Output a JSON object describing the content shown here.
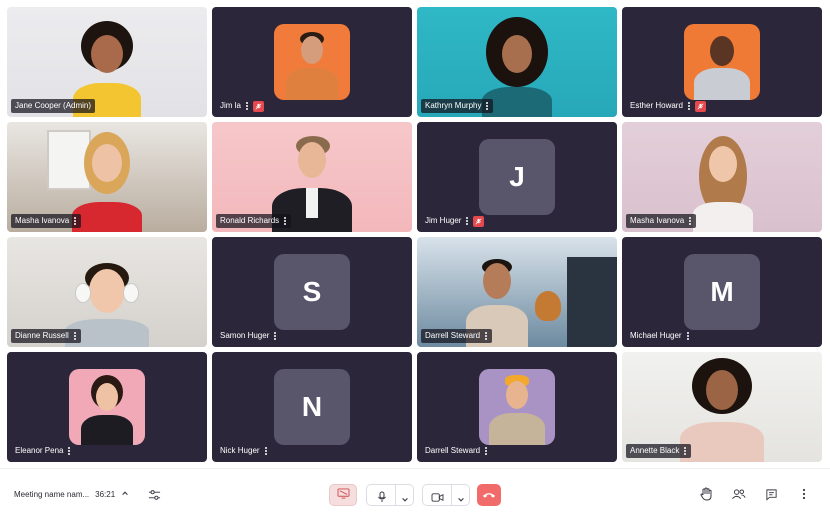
{
  "participants": [
    {
      "name": "Jane Cooper (Admin)",
      "kind": "photo",
      "muted": false
    },
    {
      "name": "Jim la",
      "kind": "avatar-photo",
      "muted": true
    },
    {
      "name": "Kathryn Murphy",
      "kind": "photo",
      "muted": false
    },
    {
      "name": "Esther Howard",
      "kind": "avatar-photo",
      "muted": true
    },
    {
      "name": "Masha Ivanova",
      "kind": "photo",
      "muted": false
    },
    {
      "name": "Ronald Richards",
      "kind": "photo",
      "muted": false
    },
    {
      "name": "Jim Huger",
      "kind": "letter",
      "letter": "J",
      "muted": true
    },
    {
      "name": "Masha Ivanova",
      "kind": "photo",
      "muted": false
    },
    {
      "name": "Dianne Russell",
      "kind": "photo",
      "muted": false
    },
    {
      "name": "Samon Huger",
      "kind": "letter",
      "letter": "S",
      "muted": false
    },
    {
      "name": "Darrell Steward",
      "kind": "photo",
      "muted": false
    },
    {
      "name": "Michael Huger",
      "kind": "letter",
      "letter": "M",
      "muted": false
    },
    {
      "name": "Eleanor Pena",
      "kind": "avatar-photo",
      "muted": false
    },
    {
      "name": "Nick Huger",
      "kind": "letter",
      "letter": "N",
      "muted": false
    },
    {
      "name": "Darrell Steward",
      "kind": "avatar-photo",
      "muted": false
    },
    {
      "name": "Annette Black",
      "kind": "photo",
      "muted": false
    }
  ],
  "toolbar": {
    "meeting_name": "Meeting name nam...",
    "elapsed": "36:21"
  },
  "colors": {
    "tile_bg": "#2b2639",
    "letter_avatar": "#59566c",
    "muted_badge": "#e5484d",
    "leave_button": "#f26b6b",
    "share_button": "#f6dede"
  },
  "icons": {
    "chevron": "chevron-up-icon",
    "settings": "sliders-icon",
    "share": "screen-share-icon",
    "mic": "microphone-icon",
    "camera": "video-camera-icon",
    "leave": "phone-hangup-icon",
    "hand": "raise-hand-icon",
    "people": "participants-icon",
    "chat": "chat-icon",
    "more": "more-vertical-icon"
  }
}
